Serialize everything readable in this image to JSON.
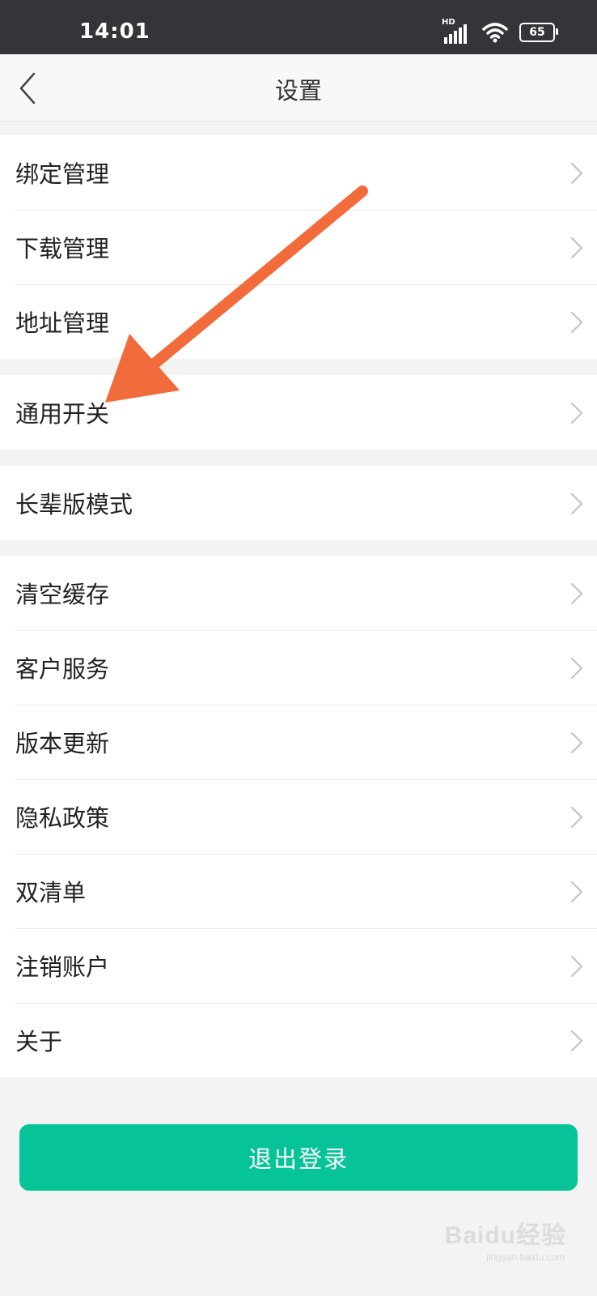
{
  "status_bar": {
    "time": "14:01",
    "network_label": "HD",
    "battery_level": "65",
    "icons": [
      "signal-icon",
      "wifi-icon",
      "battery-icon"
    ]
  },
  "header": {
    "title": "设置",
    "back_icon": "chevron-left-icon"
  },
  "sections": [
    {
      "items": [
        {
          "label": "绑定管理"
        },
        {
          "label": "下载管理"
        },
        {
          "label": "地址管理"
        }
      ]
    },
    {
      "items": [
        {
          "label": "通用开关"
        }
      ]
    },
    {
      "items": [
        {
          "label": "长辈版模式"
        }
      ]
    },
    {
      "items": [
        {
          "label": "清空缓存"
        },
        {
          "label": "客户服务"
        },
        {
          "label": "版本更新"
        },
        {
          "label": "隐私政策"
        },
        {
          "label": "双清单"
        },
        {
          "label": "注销账户"
        },
        {
          "label": "关于"
        }
      ]
    }
  ],
  "logout": {
    "label": "退出登录"
  },
  "watermark": {
    "text": "Baidu经验",
    "sub": "jingyan.baidu.com"
  },
  "annotation": {
    "type": "arrow",
    "target": "通用开关",
    "color": "#f26b3a"
  },
  "colors": {
    "accent": "#06c497",
    "status_bar": "#333538",
    "background": "#f3f3f3"
  }
}
